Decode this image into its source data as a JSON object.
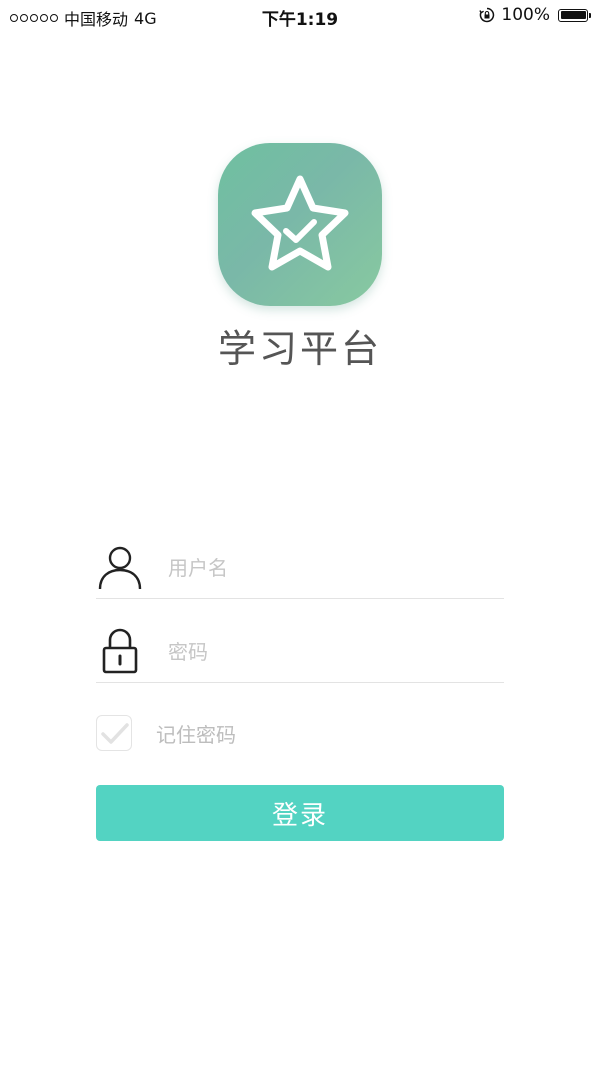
{
  "status_bar": {
    "carrier": "中国移动",
    "network": "4G",
    "time": "下午1:19",
    "battery": "100%"
  },
  "app": {
    "name": "学习平台",
    "logo_icon": "star-check-icon",
    "logo_gradient": [
      "#6fc0a0",
      "#88c9a0"
    ]
  },
  "form": {
    "username_placeholder": "用户名",
    "username_value": "",
    "password_placeholder": "密码",
    "password_value": "",
    "remember_label": "记住密码",
    "remember_checked": false,
    "login_label": "登录"
  },
  "colors": {
    "accent": "#53d3c2",
    "placeholder": "#c6c6c6"
  },
  "icons": {
    "username": "user-icon",
    "password": "lock-icon",
    "remember": "check-icon"
  }
}
